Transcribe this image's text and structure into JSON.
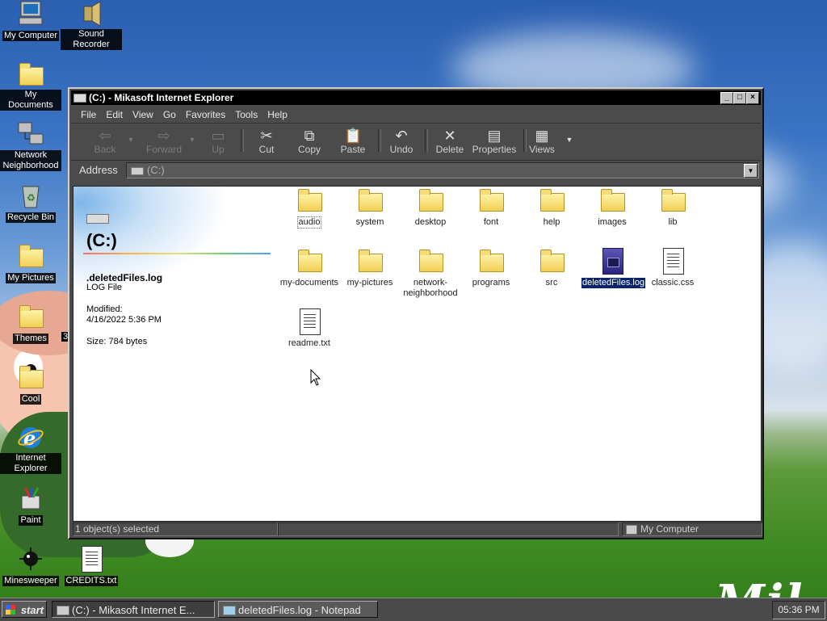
{
  "desktop": {
    "icons": [
      {
        "label": "My Computer",
        "icon": "my-computer-icon"
      },
      {
        "label": "Sound Recorder",
        "icon": "sound-recorder-icon"
      },
      {
        "label": "My Documents",
        "icon": "my-documents-folder-icon"
      },
      {
        "label": "Network Neighborhood",
        "icon": "network-neighborhood-icon"
      },
      {
        "label": "Recycle Bin",
        "icon": "recycle-bin-icon"
      },
      {
        "label": "My Pictures",
        "icon": "my-pictures-folder-icon"
      },
      {
        "label": "Themes",
        "icon": "themes-folder-icon"
      },
      {
        "label": "Cool",
        "icon": "cool-folder-icon"
      },
      {
        "label": "Internet Explorer",
        "icon": "internet-explorer-icon"
      },
      {
        "label": "Paint",
        "icon": "paint-icon"
      },
      {
        "label": "Minesweeper",
        "icon": "minesweeper-icon"
      },
      {
        "label": "CREDITS.txt",
        "icon": "text-file-icon"
      }
    ],
    "partial_label": "3"
  },
  "window": {
    "title": "(C:) - Mikasoft Internet Explorer",
    "controls": {
      "minimize": "_",
      "maximize": "□",
      "close": "×"
    },
    "menu": [
      "File",
      "Edit",
      "View",
      "Go",
      "Favorites",
      "Tools",
      "Help"
    ],
    "toolbar": {
      "back": "Back",
      "forward": "Forward",
      "up": "Up",
      "cut": "Cut",
      "copy": "Copy",
      "paste": "Paste",
      "undo": "Undo",
      "delete": "Delete",
      "properties": "Properties",
      "views": "Views"
    },
    "address": {
      "label": "Address",
      "value": "(C:)"
    },
    "info_pane": {
      "title": "(C:)",
      "selected_name": ".deletedFiles.log",
      "selected_type": "LOG File",
      "modified_label": "Modified:",
      "modified_date": "4/16/2022 5:36 PM",
      "size": "Size: 784 bytes"
    },
    "files": [
      {
        "name": "audio",
        "type": "folder"
      },
      {
        "name": "system",
        "type": "folder"
      },
      {
        "name": "desktop",
        "type": "folder"
      },
      {
        "name": "font",
        "type": "folder"
      },
      {
        "name": "help",
        "type": "folder"
      },
      {
        "name": "images",
        "type": "folder"
      },
      {
        "name": "lib",
        "type": "folder"
      },
      {
        "name": "my-documents",
        "type": "folder"
      },
      {
        "name": "my-pictures",
        "type": "folder"
      },
      {
        "name": "network-neighborhood",
        "type": "folder"
      },
      {
        "name": "programs",
        "type": "folder"
      },
      {
        "name": "src",
        "type": "folder"
      },
      {
        "name": "deletedFiles.log",
        "type": "log"
      },
      {
        "name": "classic.css",
        "type": "text"
      },
      {
        "name": "readme.txt",
        "type": "text"
      }
    ],
    "status": {
      "selection": "1 object(s) selected",
      "zone": "My Computer"
    }
  },
  "taskbar": {
    "start": "start",
    "buttons": [
      {
        "label": "(C:) - Mikasoft Internet E..."
      },
      {
        "label": "deletedFiles.log - Notepad"
      }
    ],
    "clock": "05:36 PM"
  },
  "colors": {
    "selection": "#0a246a",
    "folder": "#f1cf55",
    "titlebar": "#000000"
  }
}
